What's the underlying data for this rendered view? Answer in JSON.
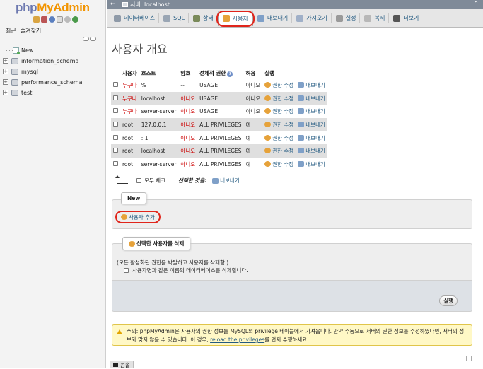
{
  "nav": {
    "logo_php": "php",
    "logo_myadmin": "MyAdmin",
    "tabs": [
      "최근",
      "즐겨찾기"
    ],
    "tree": [
      {
        "label": "New",
        "type": "new"
      },
      {
        "label": "information_schema",
        "type": "db"
      },
      {
        "label": "mysql",
        "type": "db"
      },
      {
        "label": "performance_schema",
        "type": "db"
      },
      {
        "label": "test",
        "type": "db"
      }
    ]
  },
  "serverbar": {
    "back": "←",
    "text": "서버: localhost",
    "collapse": "⌃"
  },
  "topmenu": {
    "tabs": [
      {
        "label": "데이터베이스",
        "icon": "database-icon",
        "color": "#8f9aa8"
      },
      {
        "label": "SQL",
        "icon": "sql-icon",
        "color": "#9aa6b4"
      },
      {
        "label": "상태",
        "icon": "status-icon",
        "color": "#7a8a5a"
      },
      {
        "label": "사용자",
        "icon": "users-icon",
        "color": "#e6a23a",
        "active": true
      },
      {
        "label": "내보내기",
        "icon": "export-icon",
        "color": "#7fa0c8"
      },
      {
        "label": "가져오기",
        "icon": "import-icon",
        "color": "#a0b0c8"
      },
      {
        "label": "설정",
        "icon": "settings-icon",
        "color": "#9a9a9a"
      },
      {
        "label": "복제",
        "icon": "replication-icon",
        "color": "#b8b8b8"
      },
      {
        "label": "더보기",
        "icon": "more-icon",
        "color": "#555555"
      }
    ]
  },
  "page": {
    "title": "사용자 개요"
  },
  "users_table": {
    "headers": [
      "사용자",
      "호스트",
      "암호",
      "전체적 권한",
      "허용",
      "실행"
    ],
    "edit_label": "권한 수정",
    "export_label": "내보내기",
    "rows": [
      {
        "user": "누구나",
        "host": "%",
        "password": "--",
        "privileges": "USAGE",
        "grant": "아니오",
        "any": true
      },
      {
        "user": "누구나",
        "host": "localhost",
        "password": "아니오",
        "privileges": "USAGE",
        "grant": "아니오",
        "any": true
      },
      {
        "user": "누구나",
        "host": "server-server",
        "password": "아니오",
        "privileges": "USAGE",
        "grant": "아니오",
        "any": true
      },
      {
        "user": "root",
        "host": "127.0.0.1",
        "password": "아니오",
        "privileges": "ALL PRIVILEGES",
        "grant": "예",
        "any": false
      },
      {
        "user": "root",
        "host": "::1",
        "password": "아니오",
        "privileges": "ALL PRIVILEGES",
        "grant": "예",
        "any": false
      },
      {
        "user": "root",
        "host": "localhost",
        "password": "아니오",
        "privileges": "ALL PRIVILEGES",
        "grant": "예",
        "any": false
      },
      {
        "user": "root",
        "host": "server-server",
        "password": "아니오",
        "privileges": "ALL PRIVILEGES",
        "grant": "예",
        "any": false
      }
    ],
    "check_all": "모두 체크",
    "with_selected": "선택한 것을:",
    "with_selected_export": "내보내기"
  },
  "new_section": {
    "legend": "New",
    "add_user": "사용자 추가"
  },
  "delete_section": {
    "legend": "선택한 사용자를 삭제",
    "note": "(모든 활성화된 권한을 박탈하고 사용자를 삭제함.)",
    "drop_db_option": "사용자명과 같은 이름의 데이터베이스를 삭제합니다.",
    "go": "실행"
  },
  "notice": {
    "text_before": "주의: phpMyAdmin은 사용자의 권한 정보를 MySQL의 privilege 테이블에서 가져옵니다. 만약 수동으로 서버의 권한 정보를 수정하였다면, 서버의 정보와 맞지 않을 수 있습니다. 이 경우, ",
    "link": "reload the privileges",
    "text_after": "를 먼저 수행하세요."
  },
  "console": {
    "label": "콘솔"
  },
  "colors": {
    "link": "#235a81",
    "highlight_circle": "#e0251b",
    "notice_bg": "#fff8c6"
  }
}
